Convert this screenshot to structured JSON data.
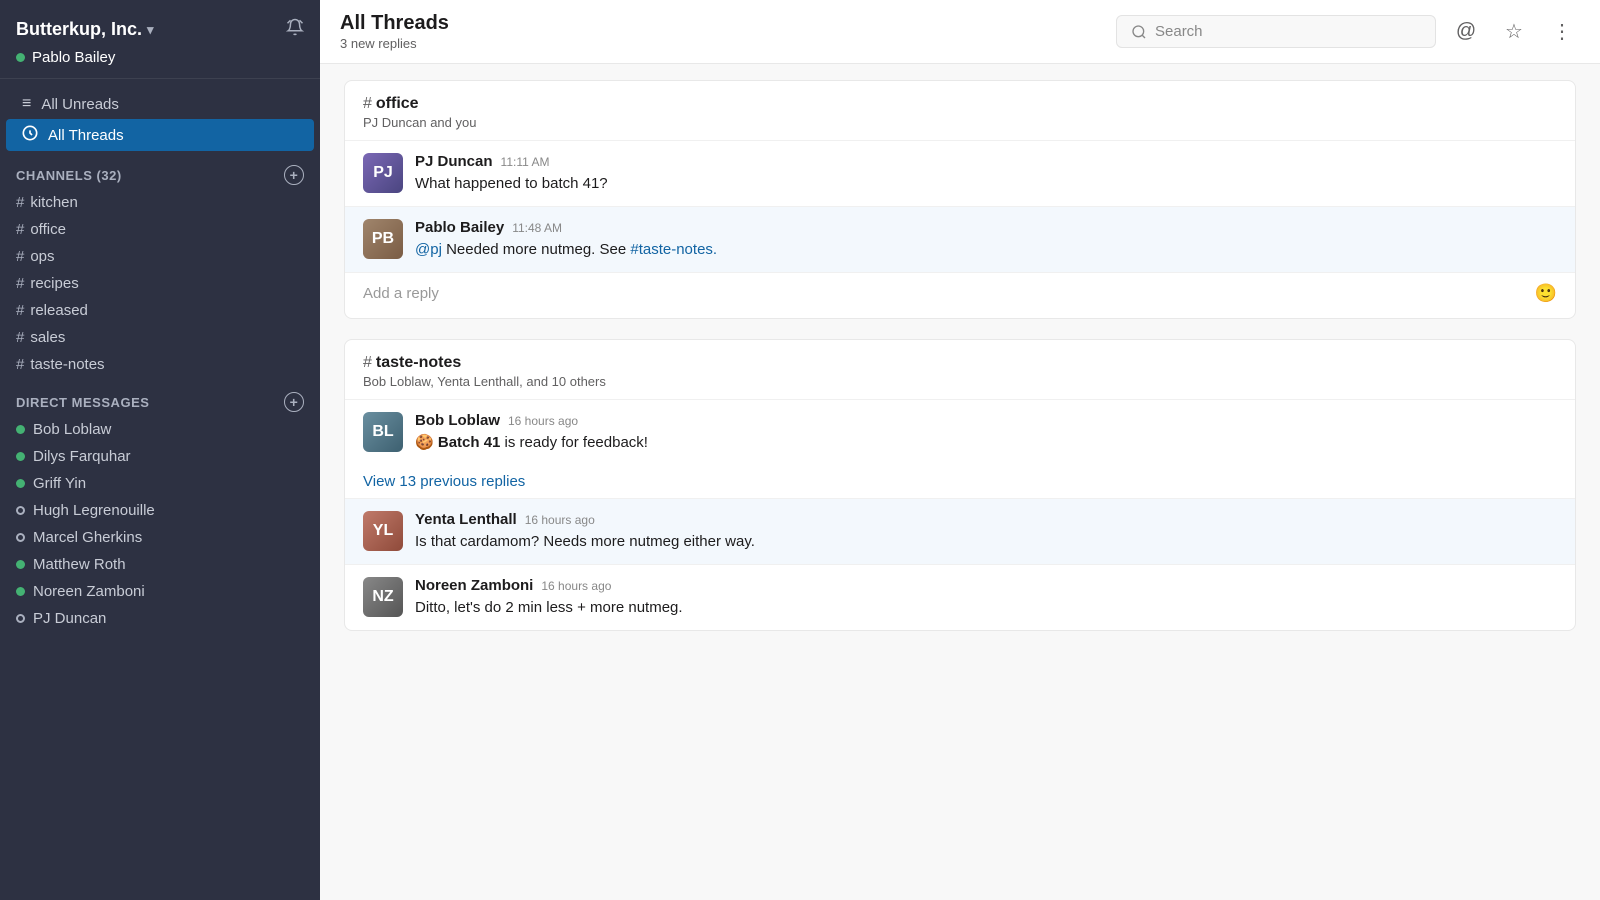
{
  "sidebar": {
    "workspace_name": "Butterkup, Inc.",
    "workspace_chevron": "▾",
    "current_user": "Pablo Bailey",
    "current_user_status": "online",
    "bell_icon": "🔔",
    "nav_items": [
      {
        "id": "all-unreads",
        "label": "All Unreads",
        "icon": "≡"
      },
      {
        "id": "all-threads",
        "label": "All Threads",
        "icon": "💬",
        "active": true
      }
    ],
    "channels_section_label": "CHANNELS",
    "channels_count": "32",
    "channels": [
      {
        "name": "kitchen"
      },
      {
        "name": "office"
      },
      {
        "name": "ops"
      },
      {
        "name": "recipes"
      },
      {
        "name": "released"
      },
      {
        "name": "sales"
      },
      {
        "name": "taste-notes"
      }
    ],
    "dm_section_label": "DIRECT MESSAGES",
    "direct_messages": [
      {
        "name": "Bob Loblaw",
        "status": "online"
      },
      {
        "name": "Dilys Farquhar",
        "status": "online"
      },
      {
        "name": "Griff Yin",
        "status": "online"
      },
      {
        "name": "Hugh Legrenouille",
        "status": "offline"
      },
      {
        "name": "Marcel Gherkins",
        "status": "offline"
      },
      {
        "name": "Matthew Roth",
        "status": "online"
      },
      {
        "name": "Noreen Zamboni",
        "status": "online"
      },
      {
        "name": "PJ Duncan",
        "status": "offline"
      }
    ]
  },
  "header": {
    "title": "All Threads",
    "subtitle": "3 new replies",
    "search_placeholder": "Search",
    "at_icon": "@",
    "star_icon": "☆",
    "more_icon": "⋮"
  },
  "thread_groups": [
    {
      "id": "office-thread",
      "channel": "office",
      "participants": "PJ Duncan and you",
      "messages": [
        {
          "id": "msg1",
          "author": "PJ Duncan",
          "time": "11:11 AM",
          "avatar_initials": "PJ",
          "avatar_class": "avatar-pj",
          "text_plain": "What happened to batch 41?",
          "highlighted": false
        },
        {
          "id": "msg2",
          "author": "Pablo Bailey",
          "time": "11:48 AM",
          "avatar_initials": "PB",
          "avatar_class": "avatar-pablo",
          "text_plain": "Needed more nutmeg. See",
          "mention": "@pj",
          "link": "#taste-notes.",
          "highlighted": true
        }
      ],
      "reply_placeholder": "Add a reply"
    },
    {
      "id": "taste-notes-thread",
      "channel": "taste-notes",
      "participants": "Bob Loblaw, Yenta Lenthall, and 10 others",
      "messages": [
        {
          "id": "msg3",
          "author": "Bob Loblaw",
          "time": "16 hours ago",
          "avatar_initials": "BL",
          "avatar_class": "avatar-bob",
          "text_plain": "Batch 41 is ready for feedback!",
          "emoji": "🍪",
          "highlighted": false
        },
        {
          "id": "msg4",
          "author": "Yenta Lenthall",
          "time": "16 hours ago",
          "avatar_initials": "YL",
          "avatar_class": "avatar-yenta",
          "text_plain": "Is that cardamom? Needs more nutmeg either way.",
          "highlighted": true
        },
        {
          "id": "msg5",
          "author": "Noreen Zamboni",
          "time": "16 hours ago",
          "avatar_initials": "NZ",
          "avatar_class": "avatar-noreen",
          "text_plain": "Ditto, let's do 2 min less + more nutmeg.",
          "highlighted": false
        }
      ],
      "view_replies_label": "View 13 previous replies"
    }
  ]
}
